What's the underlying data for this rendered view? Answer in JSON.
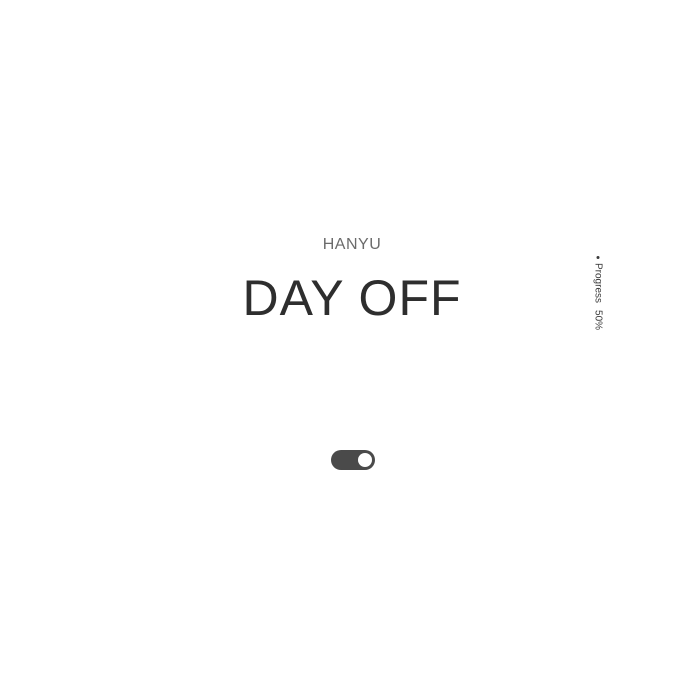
{
  "header": {
    "subtitle": "HANYU",
    "title": "DAY OFF"
  },
  "progress": {
    "label": "Progress",
    "value": 50,
    "value_text": "50%"
  },
  "toggle": {
    "on": true
  },
  "colors": {
    "background": "#ffffff",
    "title": "#2e2e2e",
    "subtitle": "#6b6b6b",
    "toggle_track": "#4a4a4a",
    "toggle_knob": "#ffffff"
  }
}
